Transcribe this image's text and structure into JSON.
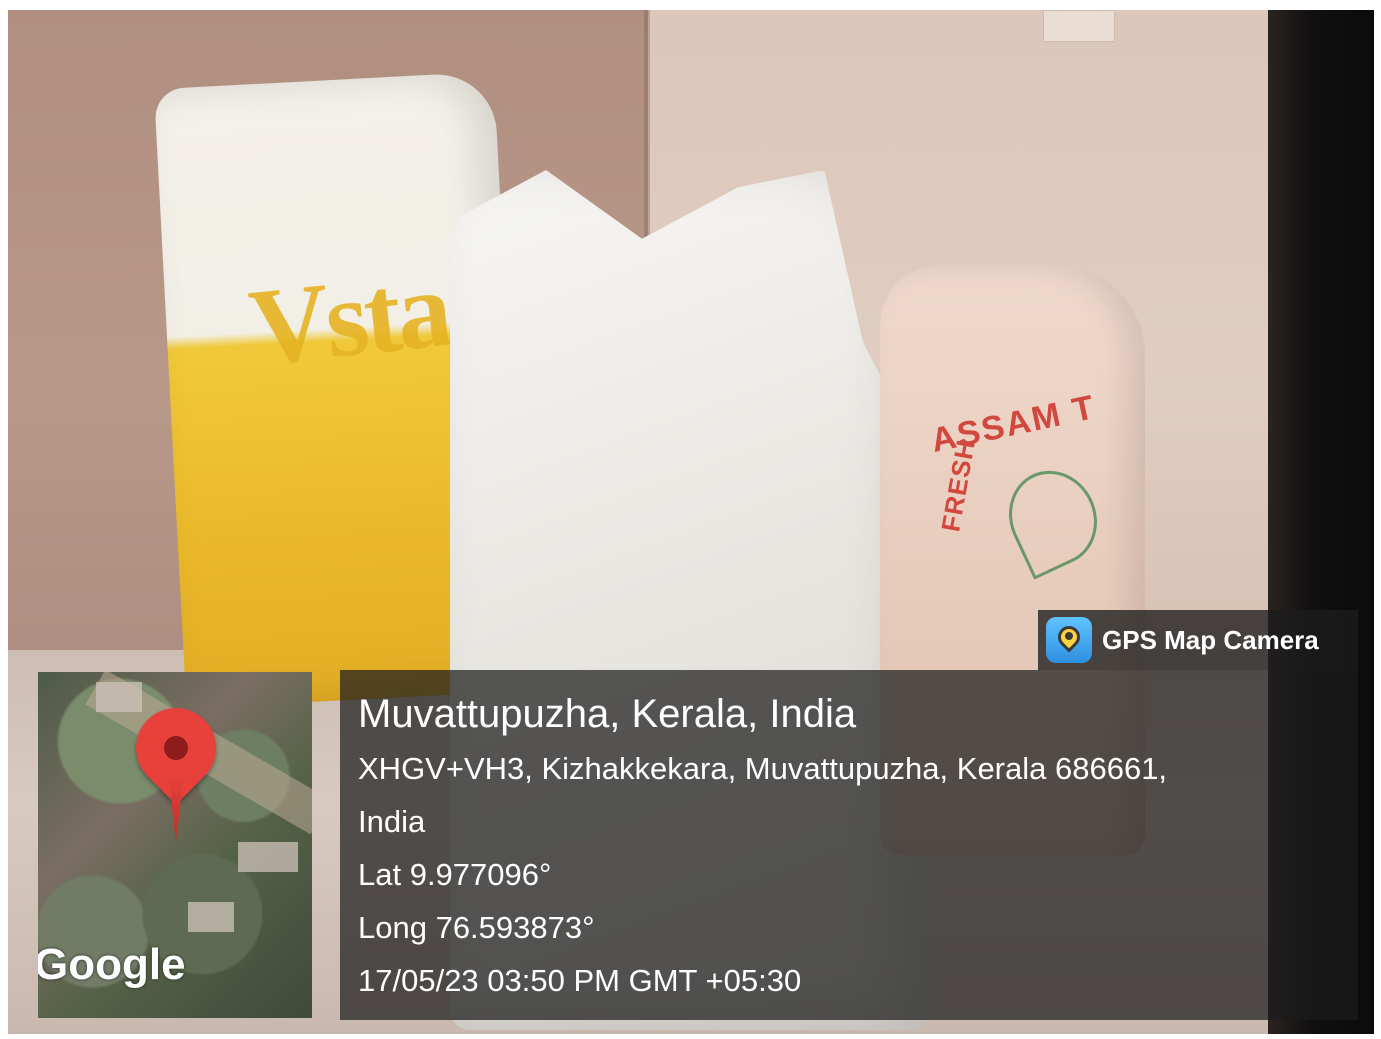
{
  "overlay": {
    "app_name": "GPS Map Camera",
    "map_logo": "Google",
    "place": "Muvattupuzha, Kerala, India",
    "address_line1": "XHGV+VH3, Kizhakkekara, Muvattupuzha, Kerala 686661,",
    "address_line2": "India",
    "lat": "Lat 9.977096°",
    "long": "Long 76.593873°",
    "datetime": "17/05/23 03:50 PM GMT +05:30"
  },
  "photo": {
    "bag_left_text": "Vsta",
    "bag_right_text_top": "ASSAM T",
    "bag_right_text_side": "FRESH",
    "icons": [
      "gps-camera-icon",
      "map-pin-icon"
    ],
    "colors": {
      "pin": "#e8413b",
      "panel": "#1c1c1c",
      "bag_yellow": "#eab82a",
      "bag_green": "#5bd448"
    }
  }
}
